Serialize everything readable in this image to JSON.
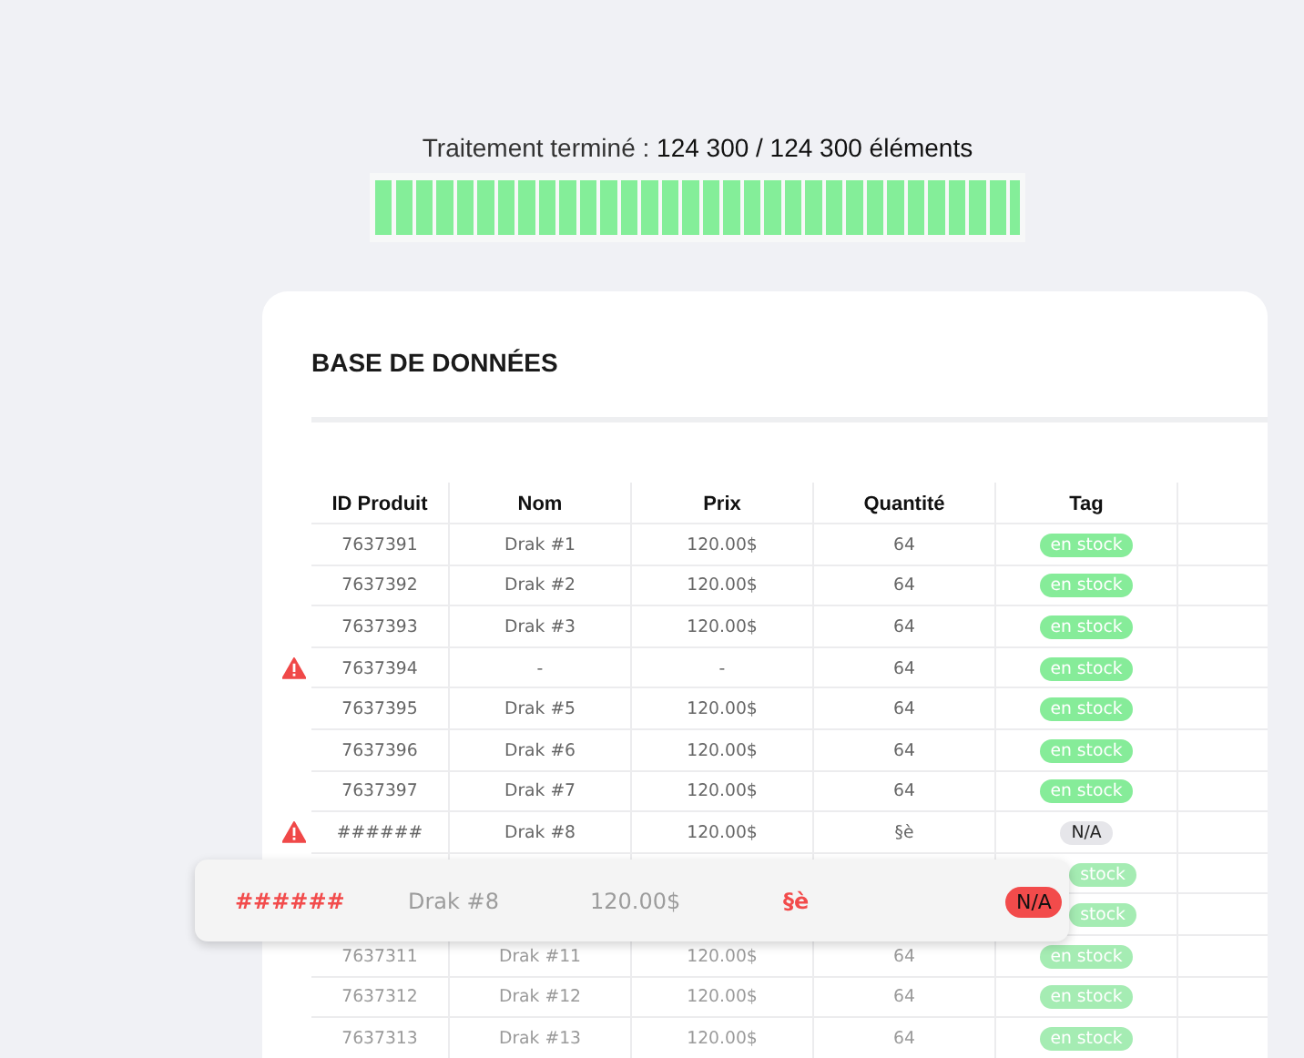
{
  "progress": {
    "caption": "Traitement terminé : ",
    "count": "124 300 / 124 300 éléments",
    "level": 1
  },
  "card": {
    "title": "BASE DE DONNÉES",
    "columns": [
      "ID Produit",
      "Nom",
      "Prix",
      "Quantité",
      "Tag"
    ],
    "rows": [
      {
        "id": "7637391",
        "name": "Drak #1",
        "price": "120.00$",
        "qty": "64",
        "tag": {
          "text": "en stock",
          "kind": "stock"
        },
        "warning": false,
        "faded": false
      },
      {
        "id": "7637392",
        "name": "Drak #2",
        "price": "120.00$",
        "qty": "64",
        "tag": {
          "text": "en stock",
          "kind": "stock"
        },
        "warning": false,
        "faded": false
      },
      {
        "id": "7637393",
        "name": "Drak #3",
        "price": "120.00$",
        "qty": "64",
        "tag": {
          "text": "en stock",
          "kind": "stock"
        },
        "warning": false,
        "faded": false
      },
      {
        "id": "7637394",
        "name": "-",
        "price": "-",
        "qty": "64",
        "tag": {
          "text": "en stock",
          "kind": "stock"
        },
        "warning": true,
        "faded": false
      },
      {
        "id": "7637395",
        "name": "Drak #5",
        "price": "120.00$",
        "qty": "64",
        "tag": {
          "text": "en stock",
          "kind": "stock"
        },
        "warning": false,
        "faded": false
      },
      {
        "id": "7637396",
        "name": "Drak #6",
        "price": "120.00$",
        "qty": "64",
        "tag": {
          "text": "en stock",
          "kind": "stock"
        },
        "warning": false,
        "faded": false
      },
      {
        "id": "7637397",
        "name": "Drak #7",
        "price": "120.00$",
        "qty": "64",
        "tag": {
          "text": "en stock",
          "kind": "stock"
        },
        "warning": false,
        "faded": false
      },
      {
        "id": "######",
        "name": "Drak #8",
        "price": "120.00$",
        "qty": "§è",
        "tag": {
          "text": "N/A",
          "kind": "na"
        },
        "warning": true,
        "faded": false
      },
      {
        "tag": {
          "text": "stock",
          "kind": "stock"
        },
        "warning": false,
        "faded": true
      },
      {
        "tag": {
          "text": "stock",
          "kind": "stock"
        },
        "warning": false,
        "faded": true
      },
      {
        "id": "7637311",
        "name": "Drak #11",
        "price": "120.00$",
        "qty": "64",
        "tag": {
          "text": "en stock",
          "kind": "stock"
        },
        "warning": false,
        "faded": true
      },
      {
        "id": "7637312",
        "name": "Drak #12",
        "price": "120.00$",
        "qty": "64",
        "tag": {
          "text": "en stock",
          "kind": "stock"
        },
        "warning": false,
        "faded": true
      },
      {
        "id": "7637313",
        "name": "Drak #13",
        "price": "120.00$",
        "qty": "64",
        "tag": {
          "text": "en stock",
          "kind": "stock"
        },
        "warning": false,
        "faded": true
      }
    ]
  },
  "error_row": {
    "cells": [
      {
        "text": "######",
        "error": true
      },
      {
        "text": "Drak #8",
        "error": false
      },
      {
        "text": "120.00$",
        "error": false
      },
      {
        "text": "§è",
        "error": true
      }
    ],
    "tag": {
      "text": "N/A",
      "kind": "error"
    }
  }
}
